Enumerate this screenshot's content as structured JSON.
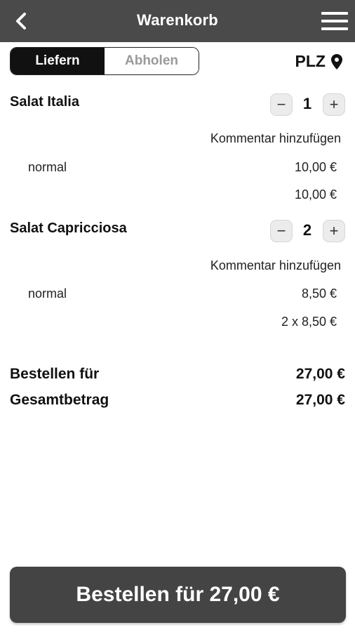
{
  "header": {
    "title": "Warenkorb",
    "back_icon": "chevron-left-icon",
    "menu_icon": "hamburger-menu-icon",
    "background_color": "#4a4a4a"
  },
  "delivery_toggle": {
    "options": [
      "Liefern",
      "Abholen"
    ],
    "selected": "Liefern"
  },
  "location": {
    "label": "PLZ",
    "icon": "map-pin-icon"
  },
  "cart_items": [
    {
      "name": "Salat Italia",
      "quantity": "1",
      "comment_label": "Kommentar hinzufügen",
      "option_name": "normal",
      "option_price": "10,00 €",
      "line_total": "10,00 €"
    },
    {
      "name": "Salat Capricciosa",
      "quantity": "2",
      "comment_label": "Kommentar hinzufügen",
      "option_name": "normal",
      "option_price": "8,50 €",
      "line_total": "2 x 8,50 €"
    }
  ],
  "summary": {
    "order_for_label": "Bestellen für",
    "order_for_value": "27,00 €",
    "total_label": "Gesamtbetrag",
    "total_value": "27,00 €"
  },
  "order_button": {
    "label": "Bestellen für 27,00 €"
  }
}
